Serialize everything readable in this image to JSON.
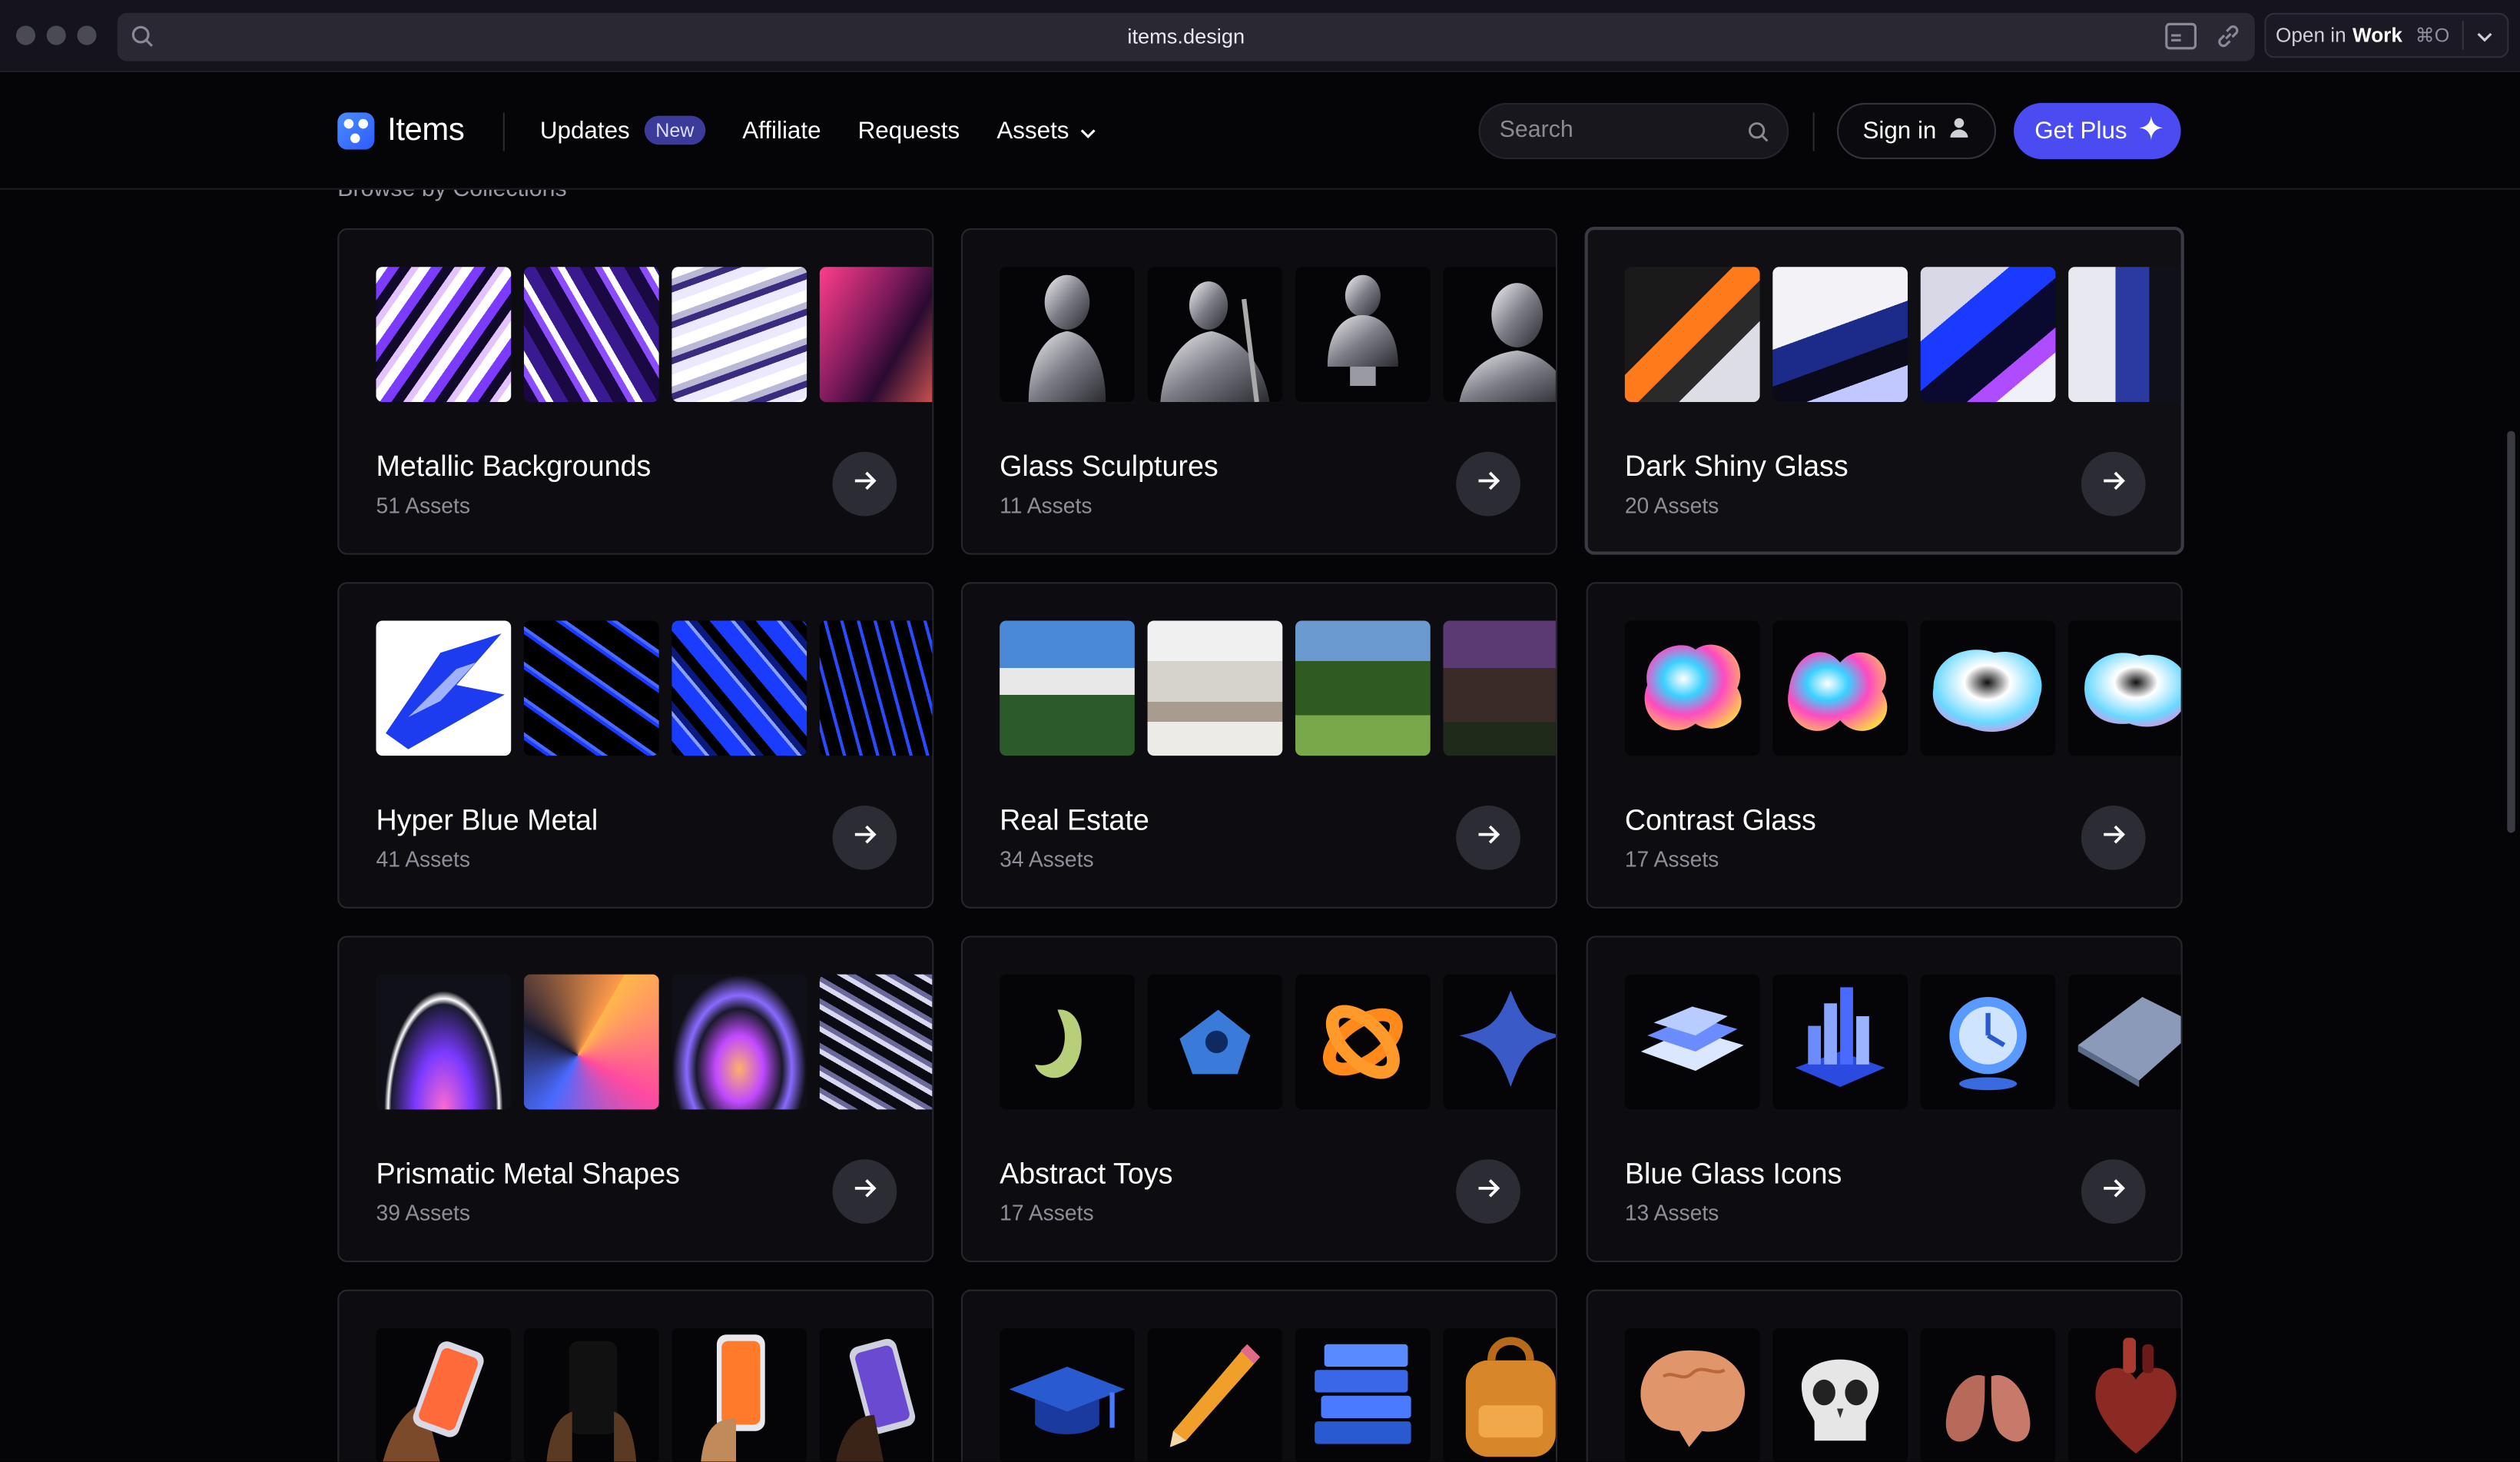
{
  "browser": {
    "url": "items.design",
    "open_in_label": "Open in",
    "open_in_app": "Work",
    "open_in_shortcut": "⌘O"
  },
  "header": {
    "logo_text": "Items",
    "nav": {
      "updates": "Updates",
      "updates_badge": "New",
      "affiliate": "Affiliate",
      "requests": "Requests",
      "assets": "Assets"
    },
    "search_placeholder": "Search",
    "signin_label": "Sign in",
    "getplus_label": "Get Plus"
  },
  "section_title": "Browse by Collections",
  "collections": [
    {
      "title": "Metallic Backgrounds",
      "count": "51 Assets"
    },
    {
      "title": "Glass Sculptures",
      "count": "11 Assets"
    },
    {
      "title": "Dark Shiny Glass",
      "count": "20 Assets"
    },
    {
      "title": "Hyper Blue Metal",
      "count": "41 Assets"
    },
    {
      "title": "Real Estate",
      "count": "34 Assets"
    },
    {
      "title": "Contrast Glass",
      "count": "17 Assets"
    },
    {
      "title": "Prismatic Metal Shapes",
      "count": "39 Assets"
    },
    {
      "title": "Abstract Toys",
      "count": "17 Assets"
    },
    {
      "title": "Blue Glass Icons",
      "count": "13 Assets"
    }
  ],
  "colors": {
    "accent": "#4a4bf0",
    "badge": "#3b3b9a",
    "card_bg": "#0d0d11"
  }
}
